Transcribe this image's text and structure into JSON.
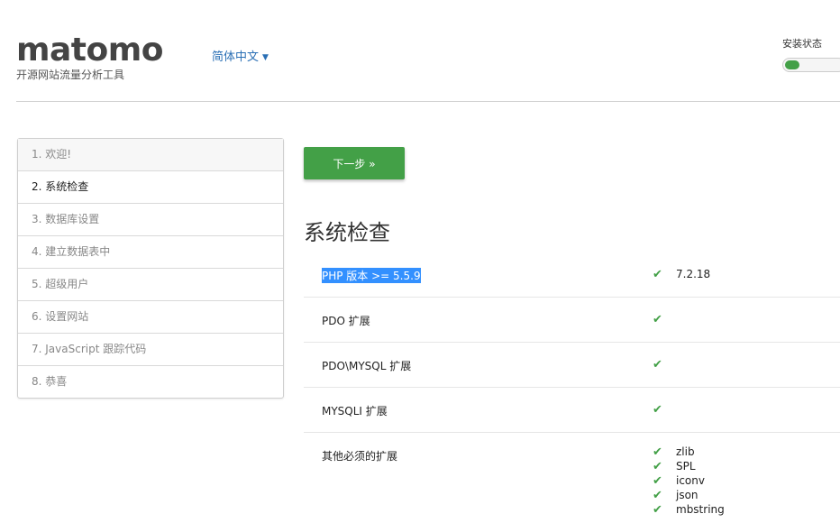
{
  "header": {
    "logo": "matomo",
    "subtitle": "开源网站流量分析工具",
    "language": "简体中文",
    "install_status_label": "安装状态",
    "install_progress": 0.25
  },
  "steps": [
    "1. 欢迎!",
    "2. 系统检查",
    "3. 数据库设置",
    "4. 建立数据表中",
    "5. 超级用户",
    "6. 设置网站",
    "7. JavaScript 跟踪代码",
    "8. 恭喜"
  ],
  "next_button": "下一步 »",
  "section_title": "系统检查",
  "checks": [
    {
      "name": "PHP 版本 >= 5.5.9",
      "value": "7.2.18"
    },
    {
      "name": "PDO 扩展",
      "value": ""
    },
    {
      "name": "PDO\\MYSQL 扩展",
      "value": ""
    },
    {
      "name": "MYSQLI 扩展",
      "value": ""
    },
    {
      "name": "其他必须的扩展",
      "values": [
        "zlib",
        "SPL",
        "iconv",
        "json",
        "mbstring"
      ]
    }
  ],
  "colors": {
    "accent": "#43a047",
    "link": "#2a6fb5",
    "selection": "#3390ff"
  }
}
